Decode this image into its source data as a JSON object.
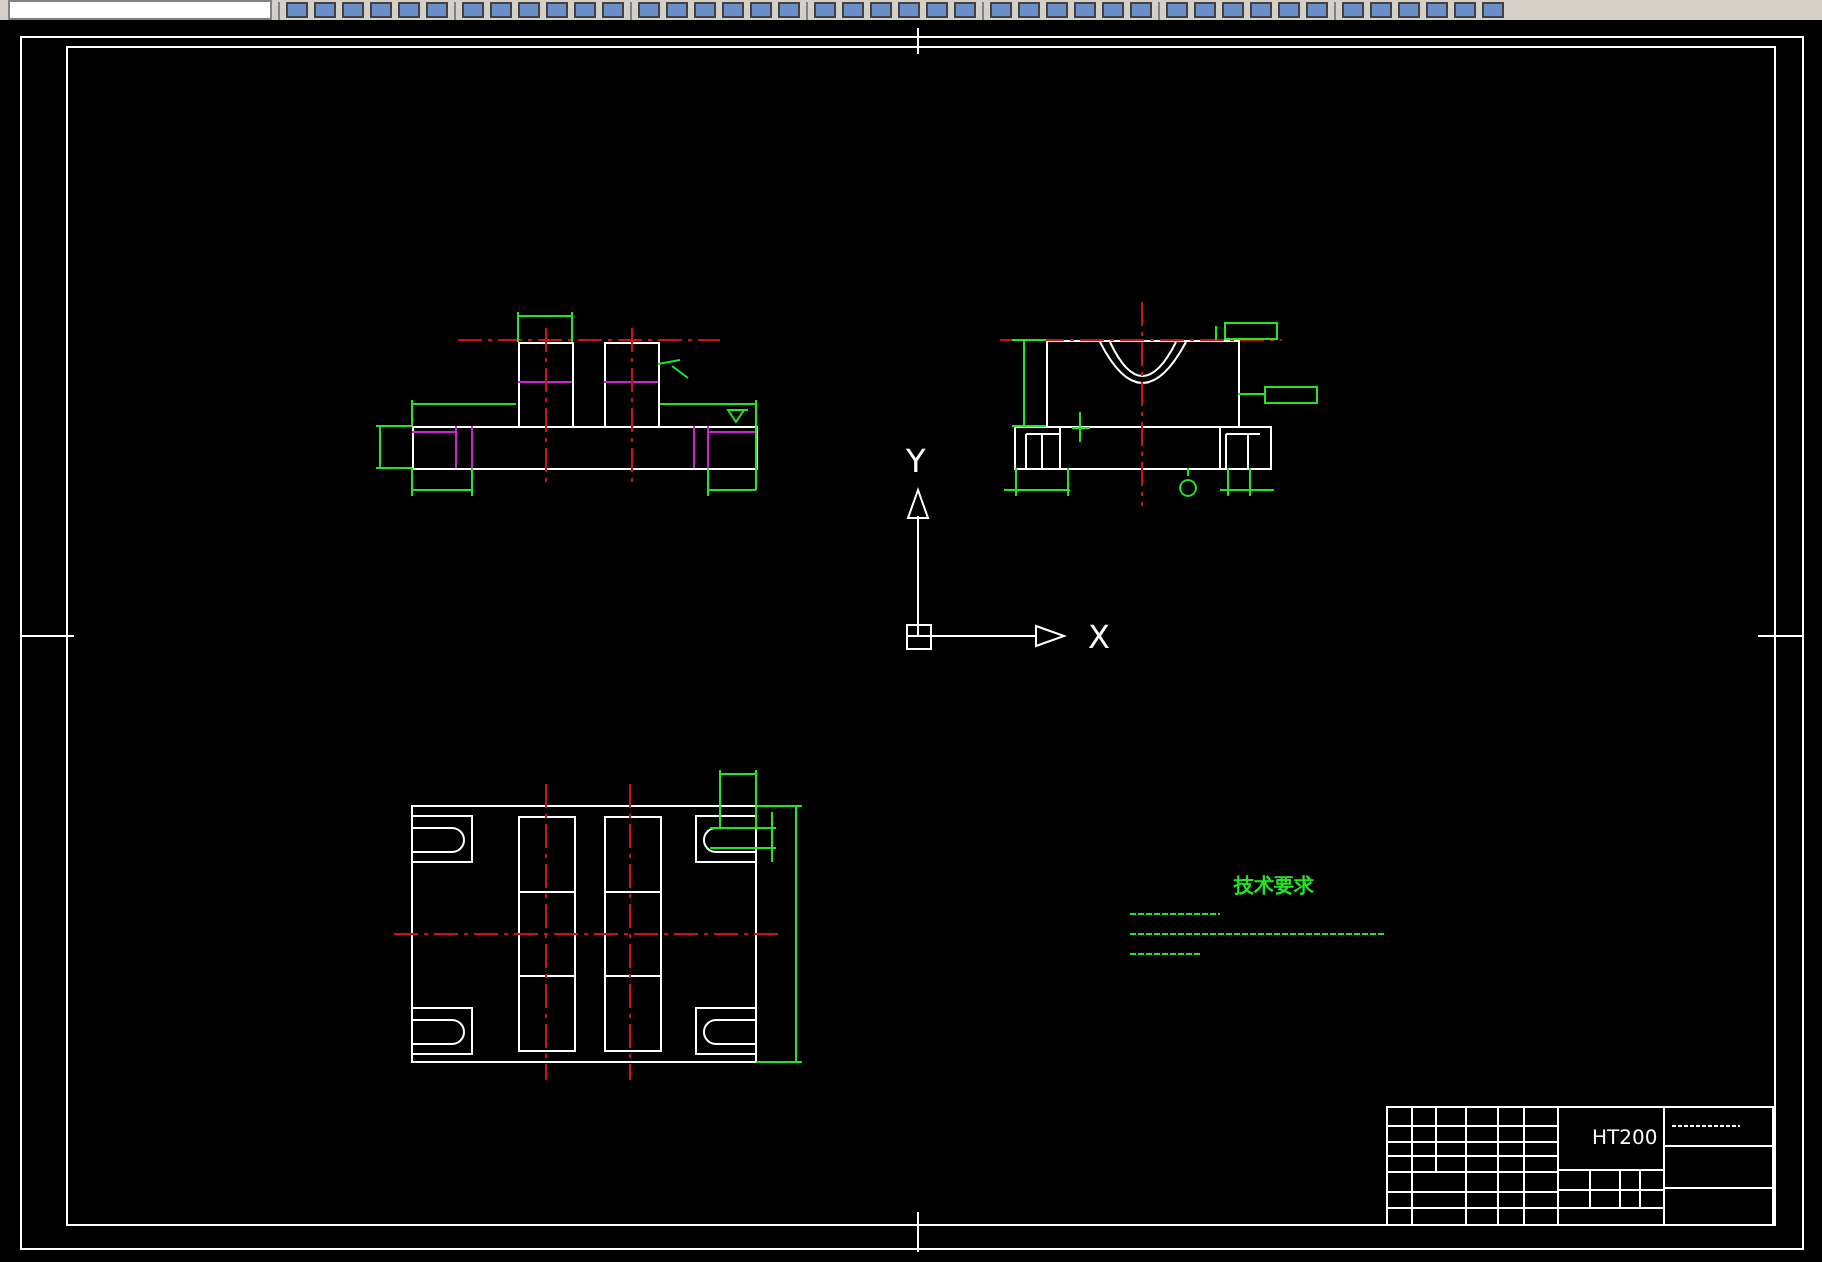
{
  "ucs": {
    "x_label": "X",
    "y_label": "Y"
  },
  "technical_requirements": {
    "title": "技术要求"
  },
  "title_block": {
    "material": "HT200"
  }
}
